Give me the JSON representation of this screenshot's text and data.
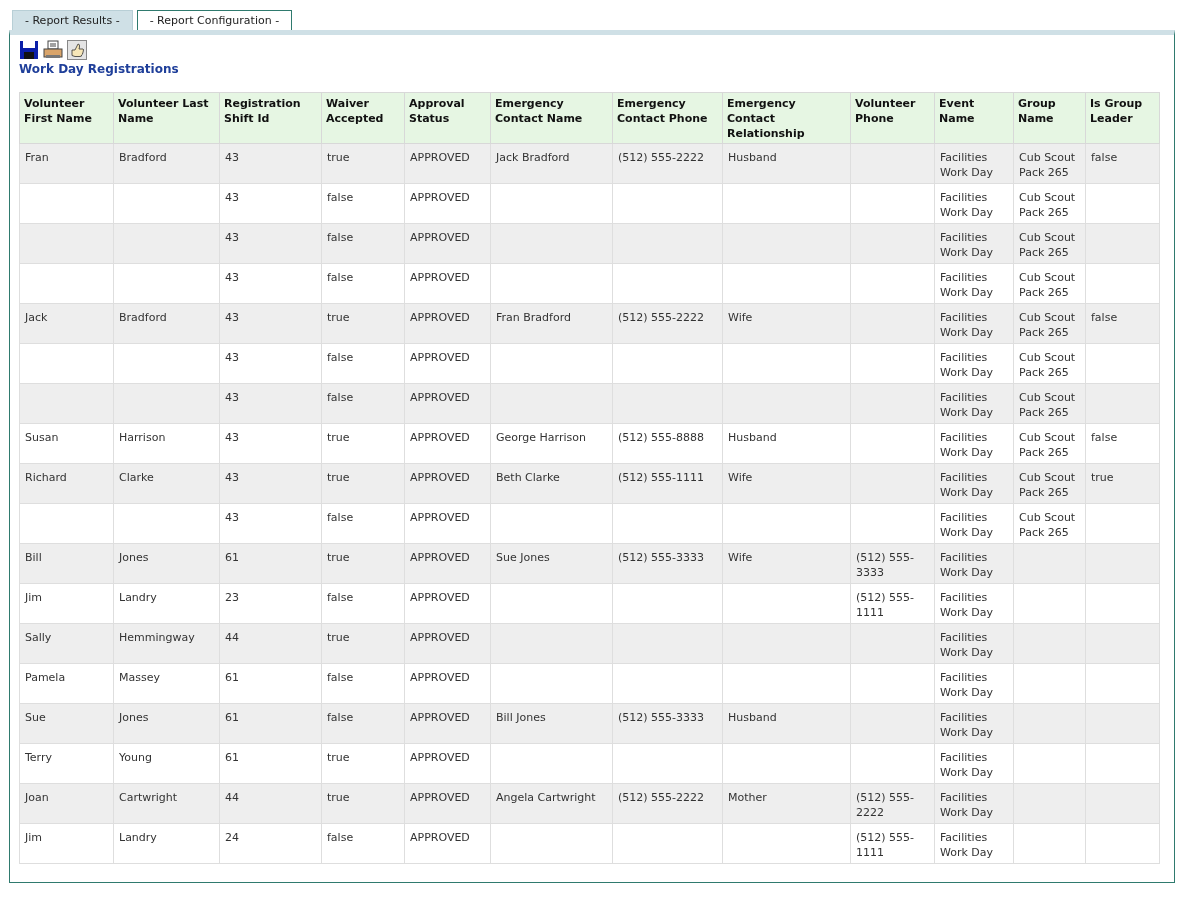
{
  "tabs": [
    {
      "label": "- Report Results -",
      "selected": true
    },
    {
      "label": "- Report Configuration -",
      "selected": false
    }
  ],
  "report_title": "Work Day Registrations",
  "table": {
    "columns": [
      "Volunteer First Name",
      "Volunteer Last Name",
      "Registration Shift Id",
      "Waiver Accepted",
      "Approval Status",
      "Emergency Contact Name",
      "Emergency Contact Phone",
      "Emergency Contact Relationship",
      "Volunteer Phone",
      "Event Name",
      "Group Name",
      "Is Group Leader"
    ],
    "rows": [
      [
        "Fran",
        "Bradford",
        "43",
        "true",
        "APPROVED",
        "Jack Bradford",
        "(512) 555-2222",
        "Husband",
        null,
        "Facilities Work Day",
        "Cub Scout Pack 265",
        "false"
      ],
      [
        null,
        null,
        "43",
        "false",
        "APPROVED",
        null,
        null,
        null,
        null,
        "Facilities Work Day",
        "Cub Scout Pack 265",
        null
      ],
      [
        null,
        null,
        "43",
        "false",
        "APPROVED",
        null,
        null,
        null,
        null,
        "Facilities Work Day",
        "Cub Scout Pack 265",
        null
      ],
      [
        null,
        null,
        "43",
        "false",
        "APPROVED",
        null,
        null,
        null,
        null,
        "Facilities Work Day",
        "Cub Scout Pack 265",
        null
      ],
      [
        "Jack",
        "Bradford",
        "43",
        "true",
        "APPROVED",
        "Fran Bradford",
        "(512) 555-2222",
        "Wife",
        null,
        "Facilities Work Day",
        "Cub Scout Pack 265",
        "false"
      ],
      [
        null,
        null,
        "43",
        "false",
        "APPROVED",
        null,
        null,
        null,
        null,
        "Facilities Work Day",
        "Cub Scout Pack 265",
        null
      ],
      [
        null,
        null,
        "43",
        "false",
        "APPROVED",
        null,
        null,
        null,
        null,
        "Facilities Work Day",
        "Cub Scout Pack 265",
        null
      ],
      [
        "Susan",
        "Harrison",
        "43",
        "true",
        "APPROVED",
        "George Harrison",
        "(512) 555-8888",
        "Husband",
        null,
        "Facilities Work Day",
        "Cub Scout Pack 265",
        "false"
      ],
      [
        "Richard",
        "Clarke",
        "43",
        "true",
        "APPROVED",
        "Beth Clarke",
        "(512) 555-1111",
        "Wife",
        null,
        "Facilities Work Day",
        "Cub Scout Pack 265",
        "true"
      ],
      [
        null,
        null,
        "43",
        "false",
        "APPROVED",
        null,
        null,
        null,
        null,
        "Facilities Work Day",
        "Cub Scout Pack 265",
        null
      ],
      [
        "Bill",
        "Jones",
        "61",
        "true",
        "APPROVED",
        "Sue Jones",
        "(512) 555-3333",
        "Wife",
        "(512) 555-3333",
        "Facilities Work Day",
        null,
        null
      ],
      [
        "Jim",
        "Landry",
        "23",
        "false",
        "APPROVED",
        null,
        null,
        null,
        "(512) 555-1111",
        "Facilities Work Day",
        null,
        null
      ],
      [
        "Sally",
        "Hemmingway",
        "44",
        "true",
        "APPROVED",
        null,
        null,
        null,
        null,
        "Facilities Work Day",
        null,
        null
      ],
      [
        "Pamela",
        "Massey",
        "61",
        "false",
        "APPROVED",
        null,
        null,
        null,
        null,
        "Facilities Work Day",
        null,
        null
      ],
      [
        "Sue",
        "Jones",
        "61",
        "false",
        "APPROVED",
        "Bill Jones",
        "(512) 555-3333",
        "Husband",
        null,
        "Facilities Work Day",
        null,
        null
      ],
      [
        "Terry",
        "Young",
        "61",
        "true",
        "APPROVED",
        null,
        null,
        null,
        null,
        "Facilities Work Day",
        null,
        null
      ],
      [
        "Joan",
        "Cartwright",
        "44",
        "true",
        "APPROVED",
        "Angela Cartwright",
        "(512) 555-2222",
        "Mother",
        "(512) 555-2222",
        "Facilities Work Day",
        null,
        null
      ],
      [
        "Jim",
        "Landry",
        "24",
        "false",
        "APPROVED",
        null,
        null,
        null,
        "(512) 555-1111",
        "Facilities Work Day",
        null,
        null
      ]
    ]
  }
}
